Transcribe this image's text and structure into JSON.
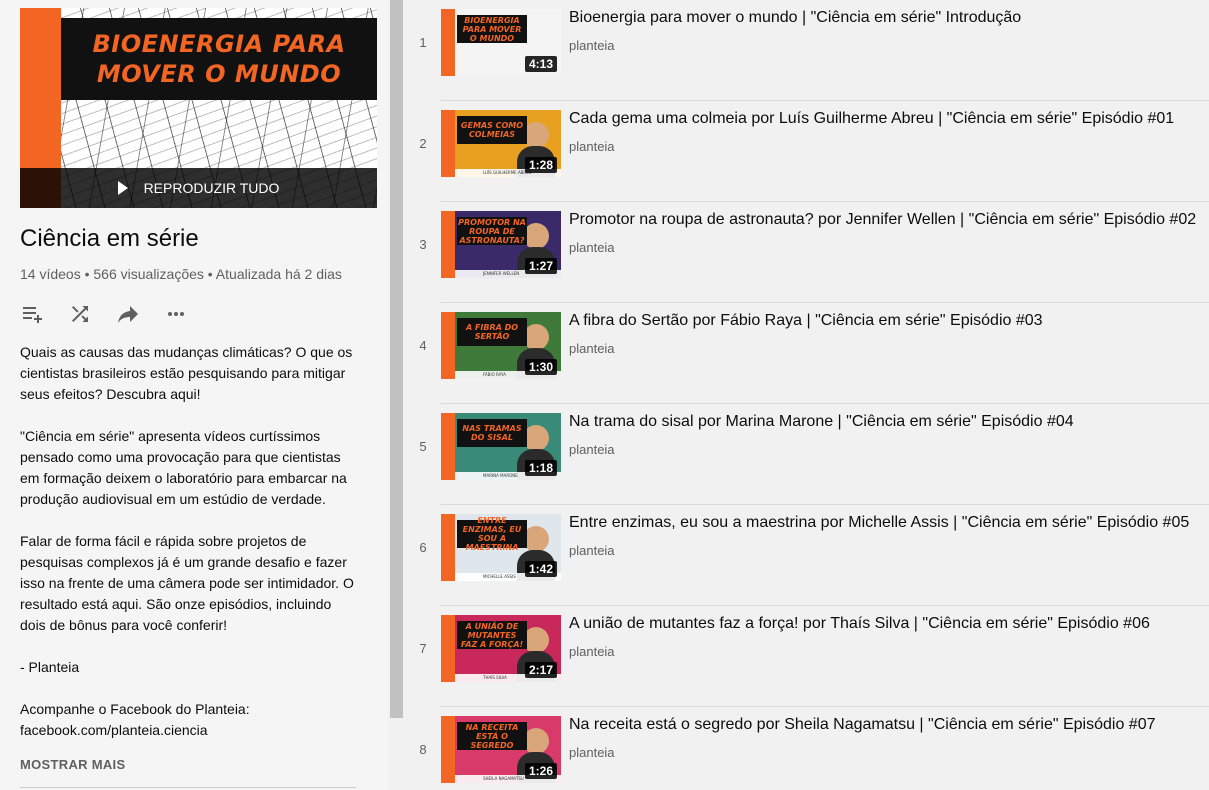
{
  "playlist": {
    "hero_text_line1": "BIOENERGIA PARA",
    "hero_text_line2": "MOVER O MUNDO",
    "play_all_label": "REPRODUZIR TUDO",
    "title": "Ciência em série",
    "stats": "14 vídeos • 566 visualizações • Atualizada há 2 dias",
    "actions": [
      "add-to-queue-icon",
      "shuffle-icon",
      "share-icon",
      "more-icon"
    ],
    "description": [
      "Quais as causas das mudanças climáticas? O que os cientistas brasileiros estão pesquisando para mitigar seus efeitos? Descubra aqui!",
      "\"Ciência em série\" apresenta vídeos curtíssimos pensado como uma provocação para que cientistas em formação deixem o laboratório para embarcar na produção audiovisual em um estúdio de verdade.",
      "Falar de forma fácil e rápida sobre projetos de pesquisas complexos já é um grande desafio e fazer isso na frente de uma câmera pode ser intimidador. O resultado está aqui. São onze episódios, incluindo dois de bônus para você conferir!",
      "- Planteia",
      "Acompanhe o Facebook do Planteia: facebook.com/planteia.ciencia"
    ],
    "show_more_label": "MOSTRAR MAIS"
  },
  "videos": [
    {
      "index": "1",
      "title": "Bioenergia para mover o mundo | \"Ciência em série\" Introdução",
      "channel": "planteia",
      "duration": "4:13",
      "thumb_text": "BIOENERGIA PARA MOVER O MUNDO",
      "thumb_name": "",
      "bg": "#f4f4f4"
    },
    {
      "index": "2",
      "title": "Cada gema uma colmeia por Luís Guilherme Abreu | \"Ciência em série\" Episódio #01",
      "channel": "planteia",
      "duration": "1:28",
      "thumb_text": "GEMAS COMO COLMEIAS",
      "thumb_name": "LUÍS GUILHERME ABREU",
      "bg": "#e8a020"
    },
    {
      "index": "3",
      "title": "Promotor na roupa de astronauta? por Jennifer Wellen | \"Ciência em série\" Episódio #02",
      "channel": "planteia",
      "duration": "1:27",
      "thumb_text": "PROMOTOR NA ROUPA DE ASTRONAUTA?",
      "thumb_name": "JENNIFER WELLEN",
      "bg": "#3a2a6a"
    },
    {
      "index": "4",
      "title": "A fibra do Sertão por Fábio Raya | \"Ciência em série\" Episódio #03",
      "channel": "planteia",
      "duration": "1:30",
      "thumb_text": "A FIBRA DO SERTÃO",
      "thumb_name": "FÁBIO RAYA",
      "bg": "#3f7a3a"
    },
    {
      "index": "5",
      "title": "Na trama do sisal por Marina Marone | \"Ciência em série\" Episódio #04",
      "channel": "planteia",
      "duration": "1:18",
      "thumb_text": "NAS TRAMAS DO SISAL",
      "thumb_name": "MARINA MARONE",
      "bg": "#3a8a7a"
    },
    {
      "index": "6",
      "title": "Entre enzimas, eu sou a maestrina por Michelle Assis | \"Ciência em série\" Episódio #05",
      "channel": "planteia",
      "duration": "1:42",
      "thumb_text": "ENTRE ENZIMAS, EU SOU A MAESTRINA",
      "thumb_name": "MICHELLE ASSIS",
      "bg": "#dfe6ec"
    },
    {
      "index": "7",
      "title": "A união de mutantes faz a força! por Thaís Silva | \"Ciência em série\" Episódio #06",
      "channel": "planteia",
      "duration": "2:17",
      "thumb_text": "A UNIÃO DE MUTANTES FAZ A FORÇA!",
      "thumb_name": "THAÍS SILVA",
      "bg": "#c8285a"
    },
    {
      "index": "8",
      "title": "Na receita está o segredo por Sheila Nagamatsu | \"Ciência em série\" Episódio #07",
      "channel": "planteia",
      "duration": "1:26",
      "thumb_text": "NA RECEITA ESTÁ O SEGREDO",
      "thumb_name": "SHEILA NAGAMATSU",
      "bg": "#d83a6a"
    }
  ]
}
